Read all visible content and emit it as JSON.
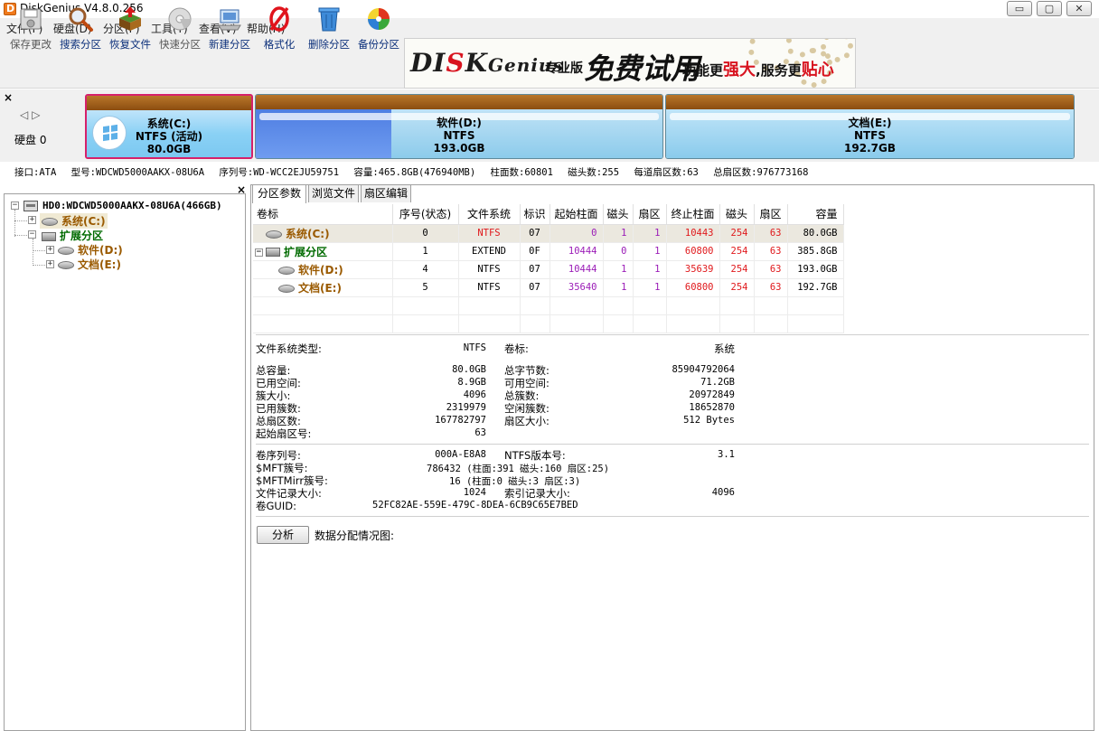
{
  "window": {
    "title": "DiskGenius V4.8.0.256",
    "buttons": {
      "minimize": "▭",
      "maximize": "▢",
      "close": "✕"
    }
  },
  "menu": [
    "文件(F)",
    "硬盘(D)",
    "分区(P)",
    "工具(T)",
    "查看(V)",
    "帮助(H)"
  ],
  "toolbar": [
    {
      "label": "保存更改",
      "icon": "save-disk-icon",
      "enabled": false
    },
    {
      "label": "搜索分区",
      "icon": "magnifier-icon",
      "enabled": true
    },
    {
      "label": "恢复文件",
      "icon": "recover-box-icon",
      "enabled": true
    },
    {
      "label": "快速分区",
      "icon": "quick-partition-icon",
      "enabled": false
    },
    {
      "label": "新建分区",
      "icon": "new-partition-icon",
      "enabled": true
    },
    {
      "label": "格式化",
      "icon": "format-icon",
      "enabled": true
    },
    {
      "label": "删除分区",
      "icon": "trash-icon",
      "enabled": true
    },
    {
      "label": "备份分区",
      "icon": "backup-icon",
      "enabled": true
    }
  ],
  "banner": {
    "logo_a": "DI",
    "logo_b": "K",
    "logo_c": "Genius",
    "edition": "专业版",
    "free": "免费试用",
    "slogan_a": "功能更",
    "slogan_b": "强大",
    "slogan_c": ",服务更",
    "slogan_d": "贴心"
  },
  "disk_map": {
    "disk_label": "硬盘 0",
    "partitions": [
      {
        "name": "系统(C:)",
        "fs": "NTFS (活动)",
        "size": "80.0GB"
      },
      {
        "name": "软件(D:)",
        "fs": "NTFS",
        "size": "193.0GB"
      },
      {
        "name": "文档(E:)",
        "fs": "NTFS",
        "size": "192.7GB"
      }
    ]
  },
  "disk_info": {
    "interface": "接口:ATA",
    "model": "型号:WDCWD5000AAKX-08U6A",
    "serial": "序列号:WD-WCC2EJU59751",
    "capacity": "容量:465.8GB(476940MB)",
    "cylinders": "柱面数:60801",
    "heads": "磁头数:255",
    "sectors_per_track": "每道扇区数:63",
    "total_sectors": "总扇区数:976773168"
  },
  "tree": {
    "disk": "HD0:WDCWD5000AAKX-08U6A(466GB)",
    "system": "系统(C:)",
    "extended": "扩展分区",
    "software": "软件(D:)",
    "documents": "文档(E:)"
  },
  "tabs": [
    "分区参数",
    "浏览文件",
    "扇区编辑"
  ],
  "table": {
    "headers": [
      "卷标",
      "序号(状态)",
      "文件系统",
      "标识",
      "起始柱面",
      "磁头",
      "扇区",
      "终止柱面",
      "磁头",
      "扇区",
      "容量"
    ],
    "rows": [
      {
        "label": "系统(C:)",
        "index": "0",
        "fs": "NTFS",
        "id": "07",
        "start_cyl": "0",
        "start_head": "1",
        "start_sec": "1",
        "end_cyl": "10443",
        "end_head": "254",
        "end_sec": "63",
        "capacity": "80.0GB"
      },
      {
        "label": "扩展分区",
        "index": "1",
        "fs": "EXTEND",
        "id": "0F",
        "start_cyl": "10444",
        "start_head": "0",
        "start_sec": "1",
        "end_cyl": "60800",
        "end_head": "254",
        "end_sec": "63",
        "capacity": "385.8GB"
      },
      {
        "label": "软件(D:)",
        "index": "4",
        "fs": "NTFS",
        "id": "07",
        "start_cyl": "10444",
        "start_head": "1",
        "start_sec": "1",
        "end_cyl": "35639",
        "end_head": "254",
        "end_sec": "63",
        "capacity": "193.0GB"
      },
      {
        "label": "文档(E:)",
        "index": "5",
        "fs": "NTFS",
        "id": "07",
        "start_cyl": "35640",
        "start_head": "1",
        "start_sec": "1",
        "end_cyl": "60800",
        "end_head": "254",
        "end_sec": "63",
        "capacity": "192.7GB"
      }
    ]
  },
  "details": {
    "fs_type_label": "文件系统类型:",
    "fs_type": "NTFS",
    "volume_label_label": "卷标:",
    "volume_label": "系统",
    "total_capacity_label": "总容量:",
    "total_capacity": "80.0GB",
    "total_bytes_label": "总字节数:",
    "total_bytes": "85904792064",
    "used_space_label": "已用空间:",
    "used_space": "8.9GB",
    "free_space_label": "可用空间:",
    "free_space": "71.2GB",
    "cluster_size_label": "簇大小:",
    "cluster_size": "4096",
    "total_clusters_label": "总簇数:",
    "total_clusters": "20972849",
    "used_clusters_label": "已用簇数:",
    "used_clusters": "2319979",
    "free_clusters_label": "空闲簇数:",
    "free_clusters": "18652870",
    "total_sectors_label": "总扇区数:",
    "total_sectors": "167782797",
    "sector_size_label": "扇区大小:",
    "sector_size": "512 Bytes",
    "start_sector_label": "起始扇区号:",
    "start_sector": "63",
    "serial_label": "卷序列号:",
    "serial": "000A-E8A8",
    "ntfs_version_label": "NTFS版本号:",
    "ntfs_version": "3.1",
    "mft_label": "$MFT簇号:",
    "mft": "786432 (柱面:391 磁头:160 扇区:25)",
    "mftmirr_label": "$MFTMirr簇号:",
    "mftmirr": "16 (柱面:0 磁头:3 扇区:3)",
    "record_size_label": "文件记录大小:",
    "record_size": "1024",
    "index_size_label": "索引记录大小:",
    "index_size": "4096",
    "guid_label": "卷GUID:",
    "guid": "52FC82AE-559E-479C-8DEA-6CB9C65E7BED"
  },
  "analyze_button": "分析",
  "alloc_label": "数据分配情况图:"
}
